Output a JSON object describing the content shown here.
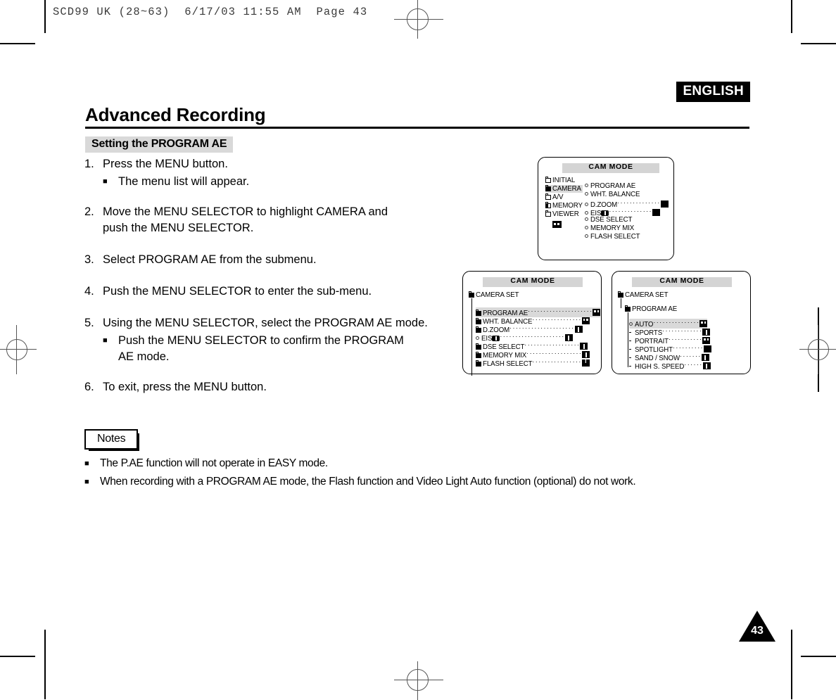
{
  "print_header": "SCD99 UK (28~63)  6/17/03 11:55 AM  Page 43",
  "language_badge": "ENGLISH",
  "page_title": "Advanced Recording",
  "section_title": "Setting the PROGRAM AE",
  "page_number": "43",
  "steps": [
    {
      "num": "1.",
      "text": "Press the MENU button.",
      "bullets": [
        "The menu list will appear."
      ]
    },
    {
      "num": "2.",
      "text": "Move the MENU SELECTOR to highlight CAMERA and push the MENU SELECTOR.",
      "bullets": []
    },
    {
      "num": "3.",
      "text": "Select PROGRAM AE from the submenu.",
      "bullets": []
    },
    {
      "num": "4.",
      "text": "Push the MENU SELECTOR to enter the sub-menu.",
      "bullets": []
    },
    {
      "num": "5.",
      "text": "Using the MENU SELECTOR, select the PROGRAM AE mode.",
      "bullets": [
        "Push the MENU SELECTOR to confirm the PROGRAM AE mode."
      ]
    },
    {
      "num": "6.",
      "text": "To exit, press the MENU button.",
      "bullets": []
    }
  ],
  "notes": {
    "label": "Notes",
    "items": [
      "The P.AE function will not operate in EASY mode.",
      "When recording with a PROGRAM AE mode, the Flash function and Video Light Auto function (optional) do not work."
    ]
  },
  "screens": {
    "screen1": {
      "title": "CAM  MODE",
      "left_items": [
        {
          "label": "INITIAL",
          "selected": false
        },
        {
          "label": "CAMERA",
          "selected": true
        },
        {
          "label": "A/V",
          "selected": false
        },
        {
          "label": "MEMORY",
          "selected": false
        },
        {
          "label": "VIEWER",
          "selected": false
        }
      ],
      "right_items": [
        {
          "label": "PROGRAM AE",
          "dots": "",
          "value": ""
        },
        {
          "label": "WHT. BALANCE",
          "dots": "",
          "value": ""
        },
        {
          "label": "D.ZOOM",
          "dots": "··············",
          "value": "square"
        },
        {
          "label": "EIS",
          "dots": "··············",
          "value": "square"
        },
        {
          "label": "DSE SELECT",
          "dots": "",
          "value": ""
        },
        {
          "label": "MEMORY MIX",
          "dots": "",
          "value": ""
        },
        {
          "label": "FLASH SELECT",
          "dots": "",
          "value": ""
        }
      ]
    },
    "screen2": {
      "title": "CAM  MODE",
      "breadcrumb": "CAMERA SET",
      "items": [
        {
          "label": "PROGRAM AE",
          "dots": "·····················",
          "value": "dual",
          "selected": true
        },
        {
          "label": "WHT. BALANCE",
          "dots": "················",
          "value": "dual",
          "selected": false
        },
        {
          "label": "D.ZOOM",
          "dots": "·····················",
          "value": "bar",
          "selected": false
        },
        {
          "label": "EIS",
          "dots": "·····················",
          "value": "bar",
          "selected": false
        },
        {
          "label": "DSE SELECT",
          "dots": "··················",
          "value": "bar",
          "selected": false
        },
        {
          "label": "MEMORY MIX",
          "dots": "··················",
          "value": "bar",
          "selected": false
        },
        {
          "label": "FLASH SELECT",
          "dots": "················",
          "value": "tbar",
          "selected": false
        }
      ]
    },
    "screen3": {
      "title": "CAM  MODE",
      "breadcrumb1": "CAMERA SET",
      "breadcrumb2": "PROGRAM AE",
      "items": [
        {
          "label": "AUTO",
          "dots": "···············",
          "icon": "auto-icon",
          "selected": true
        },
        {
          "label": "SPORTS",
          "dots": "·············",
          "icon": "sports-icon",
          "selected": false
        },
        {
          "label": "PORTRAIT",
          "dots": "···········",
          "icon": "portrait-icon",
          "selected": false
        },
        {
          "label": "SPOTLIGHT",
          "dots": "··········",
          "icon": "spotlight-icon",
          "selected": false
        },
        {
          "label": "SAND / SNOW",
          "dots": "·······",
          "icon": "sand-snow-icon",
          "selected": false
        },
        {
          "label": "HIGH S. SPEED",
          "dots": "······",
          "icon": "high-speed-icon",
          "selected": false
        }
      ]
    }
  }
}
